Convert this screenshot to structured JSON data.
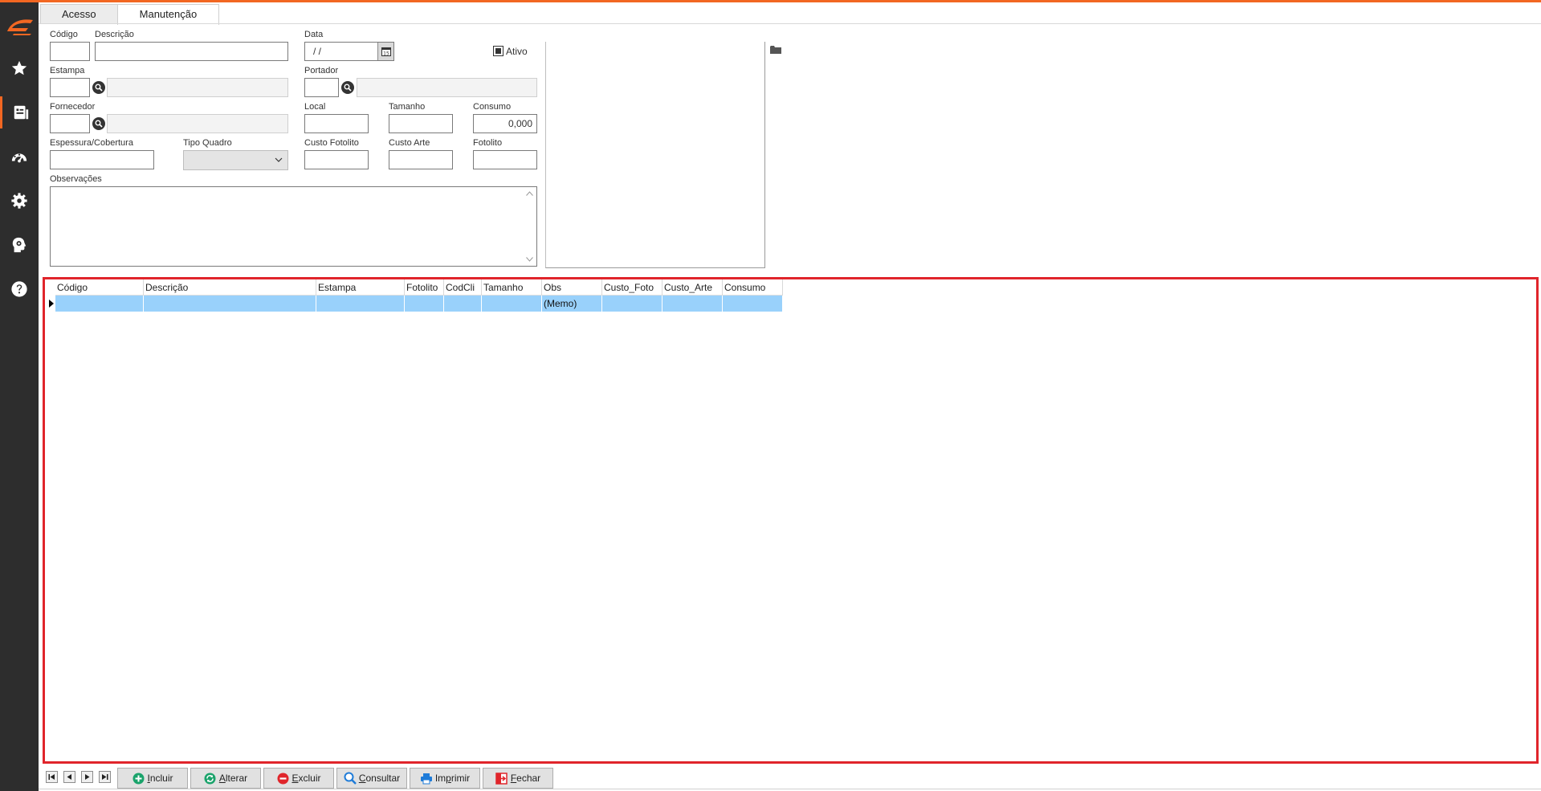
{
  "sidebar": {
    "items": [
      {
        "icon": "star-icon"
      },
      {
        "icon": "register-icon",
        "active": true
      },
      {
        "icon": "dashboard-icon"
      },
      {
        "icon": "gear-icon"
      },
      {
        "icon": "head-gear-icon"
      },
      {
        "icon": "help-icon"
      }
    ]
  },
  "tabs": [
    {
      "label": "Acesso"
    },
    {
      "label": "Manutenção",
      "active": true
    }
  ],
  "form": {
    "codigo_label": "Código",
    "descricao_label": "Descrição",
    "data_label": "Data",
    "data_value": " /  /",
    "ativo_label": "Ativo",
    "estampa_label": "Estampa",
    "portador_label": "Portador",
    "fornecedor_label": "Fornecedor",
    "local_label": "Local",
    "tamanho_label": "Tamanho",
    "consumo_label": "Consumo",
    "consumo_value": "0,000",
    "espessura_label": "Espessura/Cobertura",
    "tipo_quadro_label": "Tipo Quadro",
    "custo_fotolito_label": "Custo Fotolito",
    "custo_arte_label": "Custo Arte",
    "fotolito_label": "Fotolito",
    "observacoes_label": "Observações"
  },
  "grid": {
    "columns": [
      "Código",
      "Descrição",
      "Estampa",
      "Fotolito",
      "CodCli",
      "Tamanho",
      "Obs",
      "Custo_Foto",
      "Custo_Arte",
      "Consumo"
    ],
    "rows": [
      [
        "",
        "",
        "",
        "",
        "",
        "",
        "(Memo)",
        "",
        "",
        ""
      ]
    ]
  },
  "footer": {
    "buttons": [
      {
        "pre": "",
        "u": "I",
        "post": "ncluir",
        "icon": "plus-icon",
        "color": "#1aa36b"
      },
      {
        "pre": "",
        "u": "A",
        "post": "lterar",
        "icon": "refresh-icon",
        "color": "#1aa36b"
      },
      {
        "pre": "",
        "u": "E",
        "post": "xcluir",
        "icon": "minus-icon",
        "color": "#e0252b"
      },
      {
        "pre": "",
        "u": "C",
        "post": "onsultar",
        "icon": "search-icon",
        "color": "#1e7bd8"
      },
      {
        "pre": "Im",
        "u": "p",
        "post": "rimir",
        "icon": "printer-icon",
        "color": "#1e7bd8"
      },
      {
        "pre": "",
        "u": "F",
        "post": "echar",
        "icon": "exit-icon",
        "color": "#e0252b"
      }
    ]
  },
  "colors": {
    "accent": "#f26722",
    "sidebar": "#2d2d2d",
    "selection": "#99d1fb",
    "grid_border": "#e0252b"
  }
}
